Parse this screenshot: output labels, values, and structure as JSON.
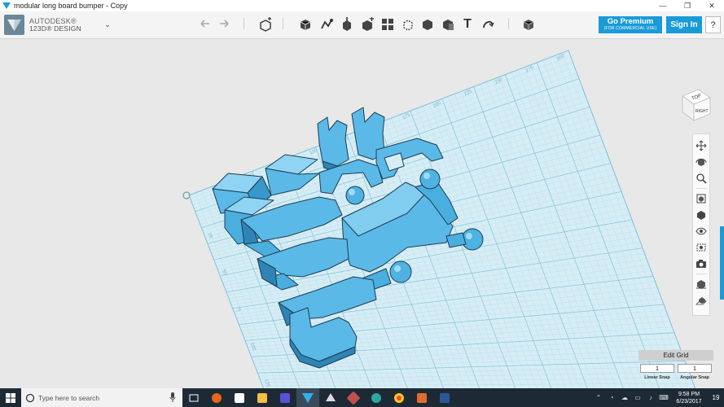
{
  "window": {
    "title": "modular long board bumper - Copy",
    "minimize": "—",
    "maximize": "❐",
    "close": "✕"
  },
  "app": {
    "brand_line1": "AUTODESK®",
    "brand_line2": "123D® DESIGN",
    "menu_chevron": "⌄",
    "accent": "#1a9bd7"
  },
  "toolbar": {
    "premium_label": "Go Premium",
    "premium_sub": "(FOR COMMERCIAL USE)",
    "signin_label": "Sign In",
    "help_label": "?",
    "text_tool": "T"
  },
  "viewcube": {
    "top_label": "TOP",
    "right_label": "RIGHT"
  },
  "grid": {
    "edit_label": "Edit Grid",
    "linear_snap_value": "1",
    "angular_snap_value": "1",
    "linear_snap_label": "Linear Snap",
    "angular_snap_label": "Angular Snap",
    "top_labels": [
      "25",
      "50",
      "75",
      "100",
      "125",
      "150",
      "175",
      "200",
      "225",
      "250",
      "275",
      "300"
    ],
    "left_labels": [
      "25",
      "50",
      "75",
      "100",
      "125"
    ]
  },
  "taskbar": {
    "search_placeholder": "Type here to search",
    "time": "9:58 PM",
    "date": "6/23/2017",
    "notifications": "19"
  }
}
